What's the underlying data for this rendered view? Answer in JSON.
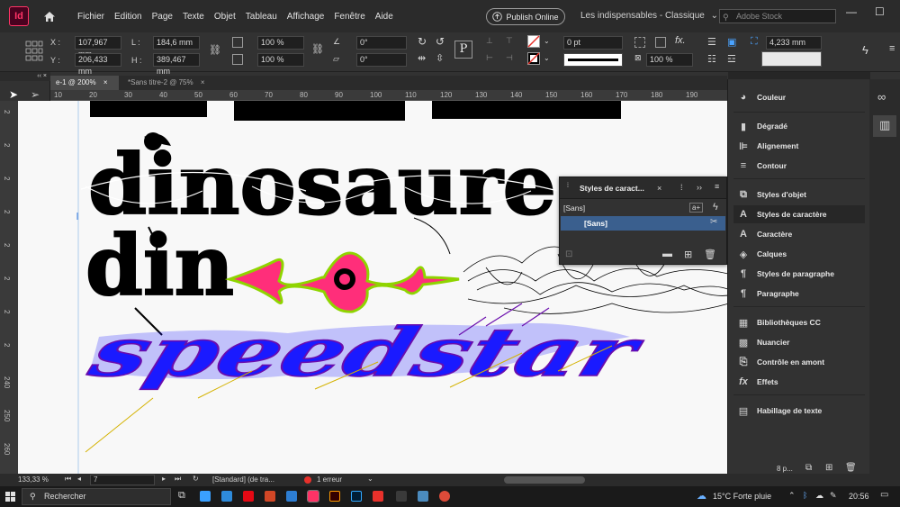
{
  "menubar": {
    "app_badge": "Id",
    "items": [
      "Fichier",
      "Edition",
      "Page",
      "Texte",
      "Objet",
      "Tableau",
      "Affichage",
      "Fenêtre",
      "Aide"
    ],
    "publish_label": "Publish Online",
    "workspace_label": "Les indispensables - Classique",
    "search_placeholder": "Adobe Stock"
  },
  "controlbar": {
    "x_label": "X :",
    "x_value": "107,967 mm",
    "y_label": "Y :",
    "y_value": "206,433 mm",
    "w_label": "L :",
    "w_value": "184,6 mm",
    "h_label": "H :",
    "h_value": "389,467 mm",
    "scale_x": "100 %",
    "scale_y": "100 %",
    "angle": "0°",
    "shear": "0°",
    "stroke_weight": "0 pt",
    "opacity": "100 %",
    "offset": "4,233 mm"
  },
  "tabs": [
    {
      "label": "e-1 @ 200%",
      "active": true
    },
    {
      "label": "*Sans titre-2 @ 75%",
      "active": false
    }
  ],
  "hruler_ticks": [
    "10",
    "20",
    "30",
    "40",
    "50",
    "60",
    "70",
    "80",
    "90",
    "100",
    "110",
    "120",
    "130",
    "140",
    "150",
    "160",
    "170",
    "180",
    "190"
  ],
  "vruler_ticks": [
    "2",
    "2",
    "2",
    "2",
    "2",
    "2",
    "2",
    "2",
    "240",
    "250",
    "260"
  ],
  "canvas_words": [
    "dinosaure",
    "din",
    "speedstar"
  ],
  "char_styles_panel": {
    "title": "Styles de caract...",
    "current": "[Sans]",
    "items": [
      "[Sans]"
    ]
  },
  "right_panel": {
    "groups": [
      [
        "Couleur"
      ],
      [
        "Dégradé",
        "Alignement",
        "Contour"
      ],
      [
        "Styles d'objet",
        "Styles de caractère",
        "Caractère",
        "Calques",
        "Styles de paragraphe",
        "Paragraphe"
      ],
      [
        "Bibliothèques CC",
        "Nuancier",
        "Contrôle en amont",
        "Effets"
      ],
      [
        "Habillage de texte"
      ]
    ],
    "footer": "8 p..."
  },
  "statusbar": {
    "zoom": "133,33 %",
    "page": "7",
    "style": "[Standard] (de tra...",
    "errors": "1 erreur"
  },
  "taskbar": {
    "search_label": "Rechercher",
    "weather": "15°C  Forte pluie",
    "time": "20:56"
  },
  "colors": {
    "brand": "#ff3366",
    "error": "#e8312b",
    "speedstar_fill": "#1a1aff",
    "blob_fill": "#ff2e7a",
    "blob_stroke": "#8fd400"
  }
}
